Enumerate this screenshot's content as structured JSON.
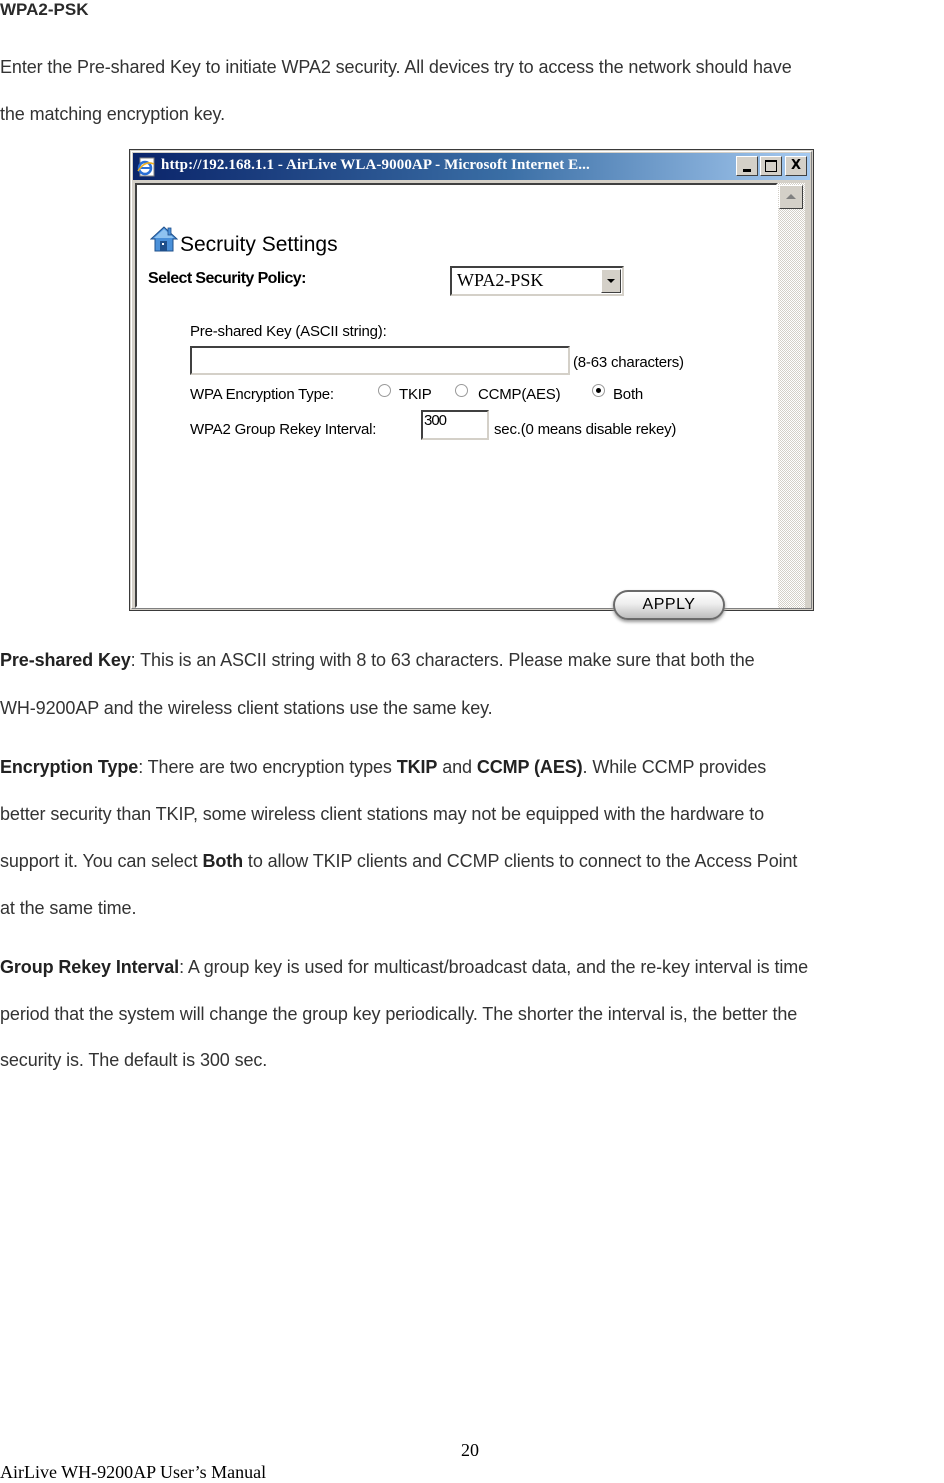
{
  "doc": {
    "heading": "WPA2-PSK",
    "intro_lines": [
      "Enter the Pre-shared Key to initiate WPA2 security. All devices try to access the network should have",
      "the matching encryption key."
    ],
    "sections": {
      "psk": {
        "term": "Pre-shared Key",
        "line1_rest": ": This is an ASCII string with 8 to 63 characters. Please make sure that both the",
        "line2": "WH-9200AP and the wireless client stations use the same key."
      },
      "enc": {
        "term": "Encryption Type",
        "l1_a": ": There are two encryption types ",
        "l1_b": "TKIP",
        "l1_c": " and ",
        "l1_d": "CCMP (AES)",
        "l1_e": ". While CCMP provides",
        "line2": "better security than TKIP, some wireless client stations may not be equipped with the hardware to",
        "l3_a": "support it. You can select ",
        "l3_b": "Both",
        "l3_c": " to allow TKIP clients and CCMP clients to connect to the Access Point",
        "line4": "at the same time."
      },
      "rekey": {
        "term": "Group Rekey Interval",
        "line1_rest": ": A group key is used for multicast/broadcast data, and the re-key interval is time",
        "line2": "period that the system will change the group key periodically. The shorter the interval is, the better the",
        "line3": "security is. The default is 300 sec."
      }
    },
    "footer": {
      "page_number": "20",
      "manual_title": "AirLive WH-9200AP User’s Manual"
    }
  },
  "browser": {
    "title": "http://192.168.1.1 - AirLive WLA-9000AP - Microsoft Internet E...",
    "buttons": {
      "minimize": "_",
      "maximize": "□",
      "close": "X"
    },
    "icons": {
      "app": "ie-icon",
      "page": "home-icon"
    },
    "page": {
      "title": "Secruity Settings",
      "policy_label": "Select Security Policy:",
      "policy_value": "WPA2-PSK",
      "psk_label": "Pre-shared Key (ASCII string):",
      "psk_value": "",
      "psk_hint": "(8-63 characters)",
      "enc_label": "WPA Encryption Type:",
      "enc_options": [
        {
          "label": "TKIP",
          "checked": false
        },
        {
          "label": "CCMP(AES)",
          "checked": false
        },
        {
          "label": "Both",
          "checked": true
        }
      ],
      "rekey_label": "WPA2 Group Rekey Interval:",
      "rekey_value": "300",
      "rekey_hint": "sec.(0 means disable rekey)",
      "apply_label": "APPLY"
    }
  }
}
